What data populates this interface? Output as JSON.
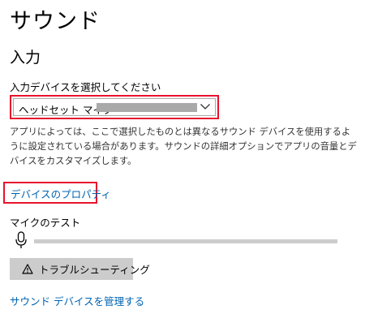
{
  "page": {
    "title": "サウンド"
  },
  "input_section": {
    "title": "入力",
    "device_label": "入力デバイスを選択してください",
    "selected_device": "ヘッドセット マイク",
    "device_name_redacted": true,
    "dropdown_icon": "chevron-down-icon",
    "description": "アプリによっては、ここで選択したものとは異なるサウンド デバイスを使用するように設定されている場合があります。サウンドの詳細オプションでアプリの音量とデバイスをカスタマイズします。",
    "device_properties_link": "デバイスのプロパティ",
    "mic_test_label": "マイクのテスト",
    "mic_icon": "microphone-icon",
    "mic_level": 0,
    "troubleshoot_icon": "warning-icon",
    "troubleshoot_button": "トラブルシューティング",
    "manage_devices_link": "サウンド デバイスを管理する"
  },
  "colors": {
    "highlight_border": "#e8112d",
    "link": "#0063b1",
    "button_bg": "#cccccc",
    "meter_track": "#cccccc",
    "redaction": "#a9a9a9"
  }
}
